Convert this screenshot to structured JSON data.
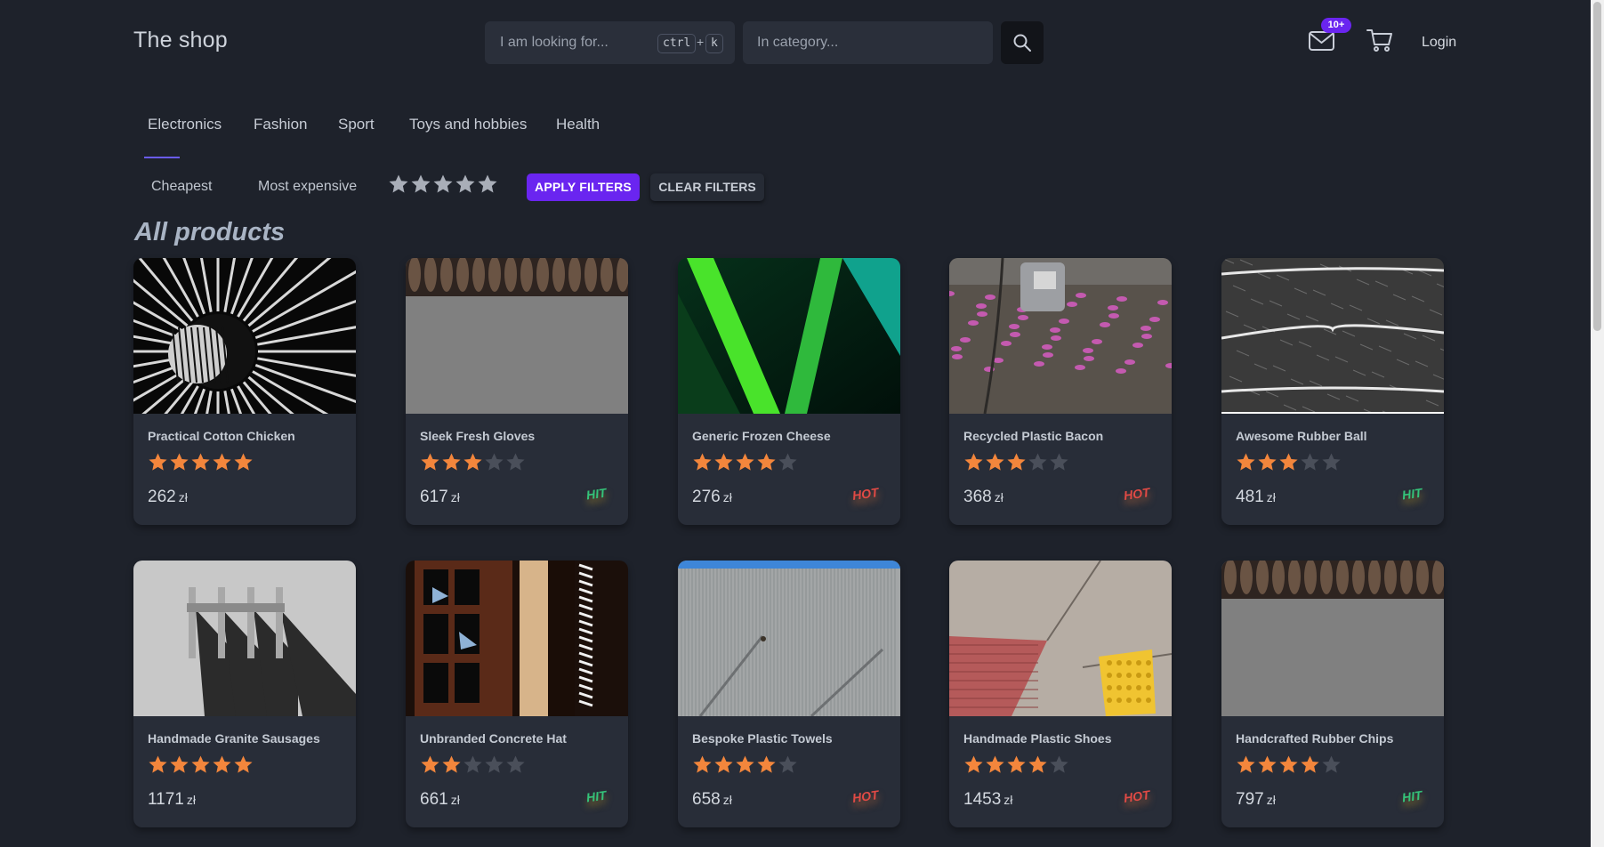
{
  "header": {
    "brand": "The shop",
    "search": {
      "placeholder": "I am looking for...",
      "shortcut_key1": "ctrl",
      "shortcut_plus": "+",
      "shortcut_key2": "k"
    },
    "category": {
      "placeholder": "In category..."
    },
    "mail_badge": "10+",
    "login_label": "Login"
  },
  "tabs": [
    {
      "label": "Electronics",
      "active": true
    },
    {
      "label": "Fashion"
    },
    {
      "label": "Sport"
    },
    {
      "label": "Toys and hobbies"
    },
    {
      "label": "Health"
    }
  ],
  "filters": {
    "cheapest": "Cheapest",
    "most_expensive": "Most expensive",
    "rating": 5,
    "apply_label": "APPLY FILTERS",
    "clear_label": "CLEAR FILTERS"
  },
  "section_title": "All products",
  "products": [
    {
      "name": "Practical Cotton Chicken",
      "rating": 5,
      "price": "262",
      "currency": "zł",
      "tag": ""
    },
    {
      "name": "Sleek Fresh Gloves",
      "rating": 3,
      "price": "617",
      "currency": "zł",
      "tag": "HIT"
    },
    {
      "name": "Generic Frozen Cheese",
      "rating": 4,
      "price": "276",
      "currency": "zł",
      "tag": "HOT"
    },
    {
      "name": "Recycled Plastic Bacon",
      "rating": 3,
      "price": "368",
      "currency": "zł",
      "tag": "HOT"
    },
    {
      "name": "Awesome Rubber Ball",
      "rating": 3,
      "price": "481",
      "currency": "zł",
      "tag": "HIT"
    },
    {
      "name": "Handmade Granite Sausages",
      "rating": 5,
      "price": "1171",
      "currency": "zł",
      "tag": ""
    },
    {
      "name": "Unbranded Concrete Hat",
      "rating": 2,
      "price": "661",
      "currency": "zł",
      "tag": "HIT"
    },
    {
      "name": "Bespoke Plastic Towels",
      "rating": 4,
      "price": "658",
      "currency": "zł",
      "tag": "HOT"
    },
    {
      "name": "Handmade Plastic Shoes",
      "rating": 4,
      "price": "1453",
      "currency": "zł",
      "tag": "HOT"
    },
    {
      "name": "Handcrafted Rubber Chips",
      "rating": 4,
      "price": "797",
      "currency": "zł",
      "tag": "HIT"
    }
  ],
  "colors": {
    "background": "#1e222b",
    "accent": "#6a25f0",
    "star_filled": "#f3863c",
    "star_empty": "#4a4f5a",
    "hit": "#34c37a",
    "hot": "#e14a45"
  }
}
